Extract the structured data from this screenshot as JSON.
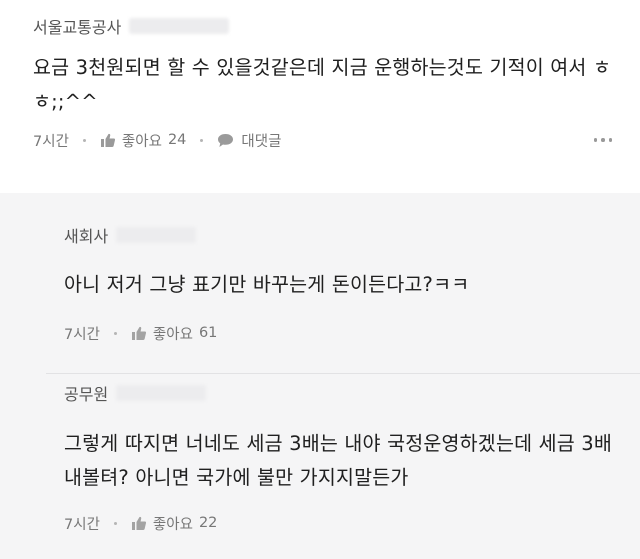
{
  "comments": [
    {
      "author": "서울교통공사",
      "text": "요금 3천원되면 할 수 있을것같은데 지금 운행하는것도 기적이 여서 ㅎㅎ;;^^",
      "time": "7시간",
      "like_label": "좋아요",
      "like_count": "24",
      "reply_label": "대댓글"
    }
  ],
  "replies": [
    {
      "author": "새회사",
      "text": "아니 저거 그냥 표기만 바꾸는게 돈이든다고?ㅋㅋ",
      "time": "7시간",
      "like_label": "좋아요",
      "like_count": "61"
    },
    {
      "author": "공무원",
      "text": "그렇게 따지면 너네도 세금 3배는 내야 국정운영하겠는데 세금 3배 내볼텨? 아니면 국가에 불만 가지지말든가",
      "time": "7시간",
      "like_label": "좋아요",
      "like_count": "22"
    }
  ],
  "icons": {
    "like": "thumbs-up-icon",
    "reply": "speech-bubble-icon",
    "more": "more-options-icon"
  }
}
